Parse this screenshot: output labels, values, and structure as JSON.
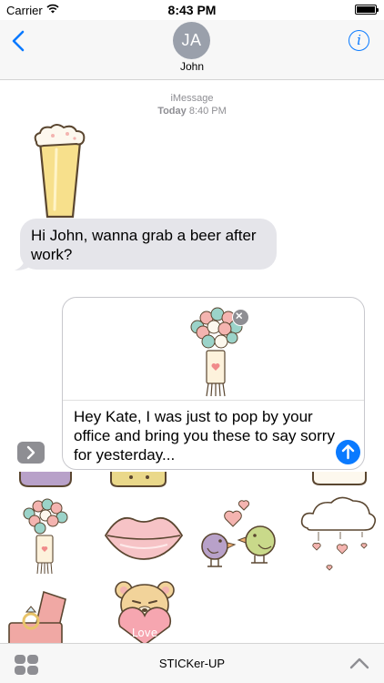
{
  "status_bar": {
    "carrier": "Carrier",
    "time": "8:43 PM"
  },
  "nav": {
    "avatar_initials": "JA",
    "contact_name": "John",
    "info_icon": "info-icon",
    "back_icon": "chevron-left-icon"
  },
  "conversation": {
    "service": "iMessage",
    "date_label": "Today",
    "time_label": "8:40 PM",
    "incoming_message": "Hi John, wanna grab a beer after work?"
  },
  "compose": {
    "text": "Hey Kate, I was just to pop by your office and bring you these to say sorry for yesterday..."
  },
  "sticker_tray": {
    "love_bear_text": "Love"
  },
  "bottom_bar": {
    "app_name": "STICKer-UP"
  },
  "colors": {
    "accent": "#0a7aff",
    "bubble_gray": "#e5e5ea",
    "avatar_gray": "#9aa0ab"
  }
}
